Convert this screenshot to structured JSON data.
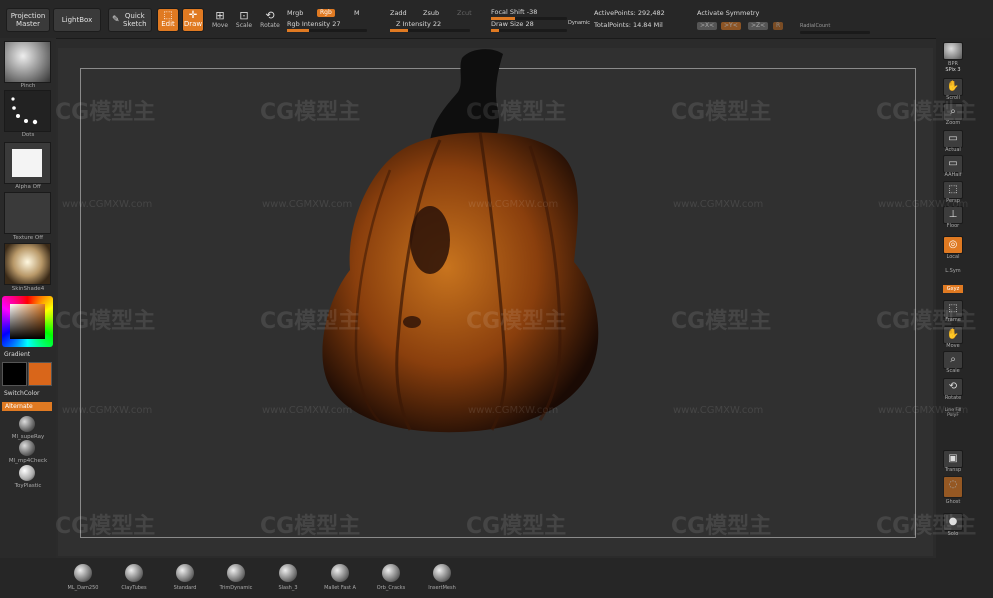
{
  "topbar": {
    "projection_master": "Projection Master",
    "lightbox": "LightBox",
    "quick_sketch": "Quick Sketch",
    "edit": "Edit",
    "draw": "Draw",
    "move": "Move",
    "scale": "Scale",
    "rotate": "Rotate",
    "mrgb": "Mrgb",
    "rgb": "Rgb",
    "m": "M",
    "rgb_intensity": "Rgb Intensity 27",
    "rgb_intensity_value": 0.27,
    "zadd": "Zadd",
    "zsub": "Zsub",
    "zcut": "Zcut",
    "z_intensity": "Z Intensity 22",
    "z_intensity_value": 0.22,
    "focal_shift": "Focal Shift -38",
    "focal_shift_value": 0.31,
    "draw_size": "Draw Size 28",
    "draw_size_value": 0.1,
    "dynamic": "Dynamic",
    "active_points": "ActivePoints: 292,482",
    "total_points": "TotalPoints: 14.84 Mil",
    "activate_symmetry": "Activate Symmetry",
    "sym_x": ">X<",
    "sym_y": ">Y<",
    "sym_z": ">Z<",
    "radial_count": "RadialCount"
  },
  "leftbar": {
    "brush_label": "Pinch",
    "stroke_label": "Dots",
    "alpha_label": "Alpha Off",
    "texture_label": "Texture Off",
    "material_label": "SkinShade4",
    "gradient": "Gradient",
    "switch_color": "SwitchColor",
    "alternate": "Alternate",
    "mat1": "Ml_supeRay",
    "mat2": "Ml_mp4Check",
    "mat3": "ToyPlastic"
  },
  "rightbar": {
    "bpr": "BPR",
    "spix": "SPix 3",
    "scroll": "Scroll",
    "zoom": "Zoom",
    "actual": "Actual",
    "aahalf": "AAHalf",
    "persp": "Persp",
    "floor": "Floor",
    "local": "Local",
    "lsym": "L.Sym",
    "xyz": "Gxyz",
    "frame": "Frame",
    "move": "Move",
    "scale": "Scale",
    "rotate": "Rotate",
    "linefill": "Line Fill PolyF",
    "transp": "Transp",
    "ghost": "Ghost",
    "solo": "Solo"
  },
  "bottombar": {
    "materials": [
      "ML_Dam250",
      "ClayTubes",
      "Standard",
      "TrimDynamic",
      "Slash_3",
      "Mallet Fast A",
      "Orb_Cracks",
      "InsertMesh"
    ]
  },
  "colors": {
    "accent": "#e07a22",
    "secondary_color": "#d9661a",
    "primary_color": "#000000"
  },
  "watermark": {
    "logo": "CG模型主",
    "url": "www.CGMXW.com"
  }
}
